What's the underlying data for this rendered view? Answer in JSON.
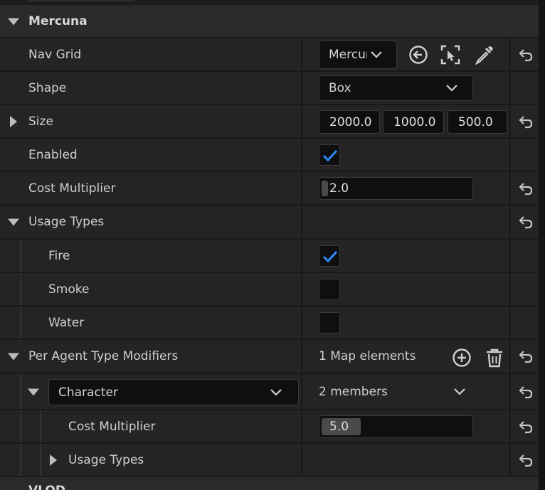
{
  "section": {
    "title": "Mercuna"
  },
  "nav_grid": {
    "label": "Nav Grid",
    "value": "Mercuna"
  },
  "shape": {
    "label": "Shape",
    "value": "Box"
  },
  "size": {
    "label": "Size",
    "x": "2000.0",
    "y": "1000.0",
    "z": "500.0"
  },
  "enabled": {
    "label": "Enabled",
    "checked": true
  },
  "cost_multiplier": {
    "label": "Cost Multiplier",
    "value": "2.0"
  },
  "usage_types": {
    "label": "Usage Types",
    "items": [
      {
        "label": "Fire",
        "checked": true
      },
      {
        "label": "Smoke",
        "checked": false
      },
      {
        "label": "Water",
        "checked": false
      }
    ]
  },
  "per_agent": {
    "label": "Per Agent Type Modifiers",
    "summary": "1 Map elements",
    "entry": {
      "key": "Character",
      "summary": "2 members",
      "cost_label": "Cost Multiplier",
      "cost_value": "5.0",
      "usage_label": "Usage Types"
    }
  },
  "next_section_partial": "VLOD",
  "colors": {
    "panel": "#242424",
    "field": "#0f0f0f",
    "check_accent": "#2f8cff",
    "text": "#cfcfcf"
  },
  "icons": [
    "reset-arrow-icon",
    "browse-back-icon",
    "select-actor-icon",
    "eyedropper-icon",
    "add-element-icon",
    "trash-icon",
    "chevron-down-icon",
    "checkmark-icon"
  ]
}
